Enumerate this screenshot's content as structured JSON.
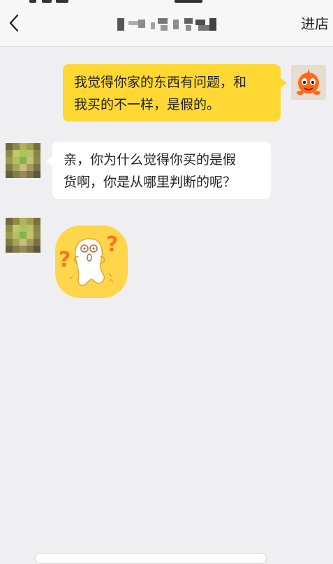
{
  "header": {
    "back_icon": "chevron-left-icon",
    "enter_store_label": "进店"
  },
  "messages": [
    {
      "sender": "me",
      "type": "text",
      "lines": [
        "我觉得你家的东西有问题，和",
        "我买的不一样，是假的。"
      ]
    },
    {
      "sender": "them",
      "type": "text",
      "lines": [
        "亲，你为什么觉得你买的是假",
        "货啊，你是从哪里判断的呢？"
      ]
    },
    {
      "sender": "them",
      "type": "sticker",
      "sticker": "confused-question-mark-sticker"
    }
  ],
  "colors": {
    "my_bubble": "#ffd834",
    "their_bubble": "#ffffff",
    "background": "#efeff2"
  }
}
